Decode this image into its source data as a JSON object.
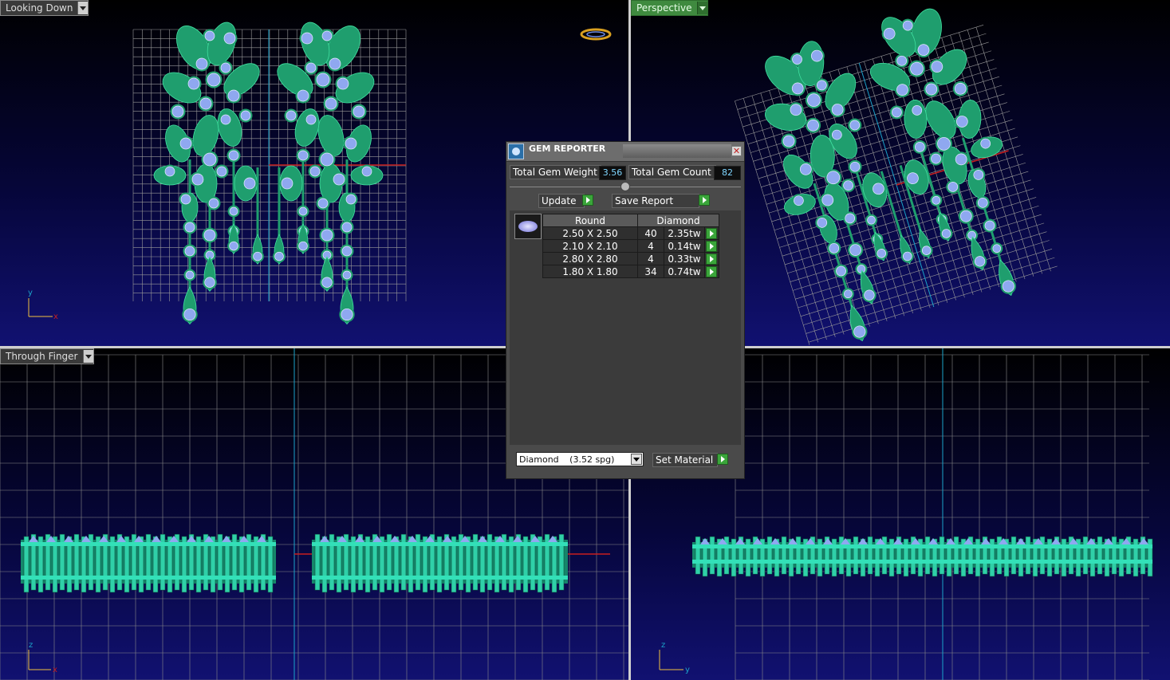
{
  "viewports": {
    "top_left": {
      "label": "Looking Down",
      "axis_v": "y",
      "axis_h": "x"
    },
    "top_right": {
      "label": "Perspective"
    },
    "bottom_left": {
      "label": "Through Finger",
      "axis_v": "z",
      "axis_h": "x"
    },
    "bottom_right": {
      "axis_v": "z",
      "axis_h": "y"
    }
  },
  "gem_reporter": {
    "title": "GEM REPORTER",
    "total_weight_label": "Total Gem Weight",
    "total_weight_value": "3.56",
    "total_count_label": "Total Gem Count",
    "total_count_value": "82",
    "update_label": "Update",
    "save_report_label": "Save Report",
    "table": {
      "headers": [
        "Round",
        "Diamond"
      ],
      "rows": [
        {
          "size": "2.50 X 2.50",
          "count": "40",
          "weight": "2.35tw"
        },
        {
          "size": "2.10 X 2.10",
          "count": "4",
          "weight": "0.14tw"
        },
        {
          "size": "2.80 X 2.80",
          "count": "4",
          "weight": "0.33tw"
        },
        {
          "size": "1.80 X 1.80",
          "count": "34",
          "weight": "0.74tw"
        }
      ]
    },
    "material_name": "Diamond",
    "material_sg": "(3.52 spg)",
    "set_material_label": "Set Material"
  },
  "colors": {
    "metal": "#1f9e6e",
    "gem": "#8fa8f0",
    "grid": "#9a9a9a",
    "axis_cyan": "#1ba3c9",
    "axis_red": "#c81e1e",
    "go_button": "#3aa53a"
  },
  "icons": [
    "gem-reporter-icon",
    "close-icon",
    "dropdown-arrow-icon",
    "go-arrow-icon",
    "gem-shape-icon",
    "ring-gizmo-icon"
  ]
}
